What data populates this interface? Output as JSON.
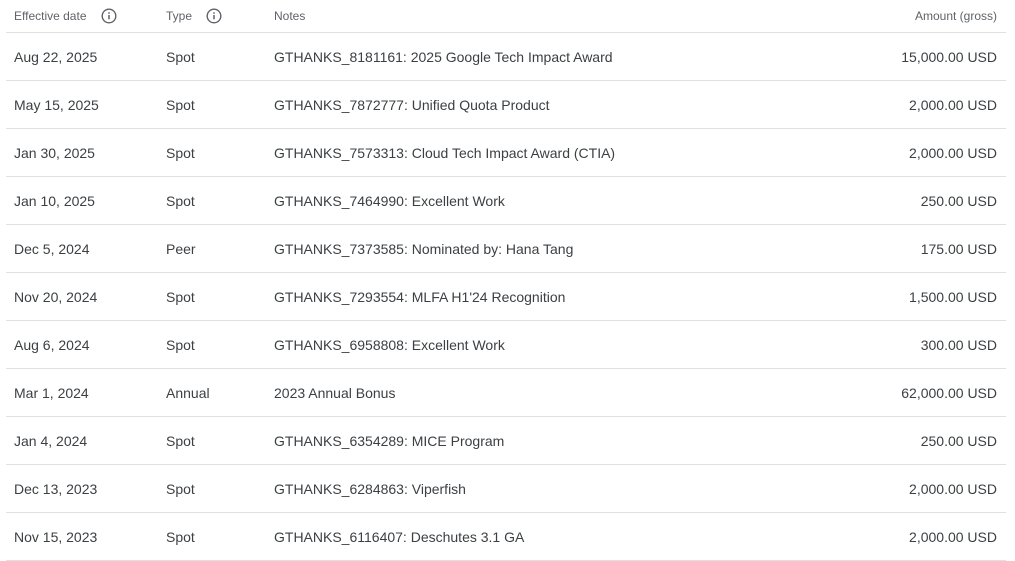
{
  "header": {
    "effective_date": "Effective date",
    "type": "Type",
    "notes": "Notes",
    "amount": "Amount (gross)",
    "info_icon": "info-icon"
  },
  "rows": [
    {
      "date": "Aug 22, 2025",
      "type": "Spot",
      "notes": "GTHANKS_8181161: 2025 Google Tech Impact Award",
      "amount": "15,000.00 USD"
    },
    {
      "date": "May 15, 2025",
      "type": "Spot",
      "notes": "GTHANKS_7872777: Unified Quota Product",
      "amount": "2,000.00 USD"
    },
    {
      "date": "Jan 30, 2025",
      "type": "Spot",
      "notes": "GTHANKS_7573313: Cloud Tech Impact Award (CTIA)",
      "amount": "2,000.00 USD"
    },
    {
      "date": "Jan 10, 2025",
      "type": "Spot",
      "notes": "GTHANKS_7464990: Excellent Work",
      "amount": "250.00 USD"
    },
    {
      "date": "Dec 5, 2024",
      "type": "Peer",
      "notes": "GTHANKS_7373585: Nominated by: Hana Tang",
      "amount": "175.00 USD"
    },
    {
      "date": "Nov 20, 2024",
      "type": "Spot",
      "notes": "GTHANKS_7293554: MLFA H1'24 Recognition",
      "amount": "1,500.00 USD"
    },
    {
      "date": "Aug 6, 2024",
      "type": "Spot",
      "notes": "GTHANKS_6958808: Excellent Work",
      "amount": "300.00 USD"
    },
    {
      "date": "Mar 1, 2024",
      "type": "Annual",
      "notes": "2023 Annual Bonus",
      "amount": "62,000.00 USD"
    },
    {
      "date": "Jan 4, 2024",
      "type": "Spot",
      "notes": "GTHANKS_6354289: MICE Program",
      "amount": "250.00 USD"
    },
    {
      "date": "Dec 13, 2023",
      "type": "Spot",
      "notes": "GTHANKS_6284863: Viperfish",
      "amount": "2,000.00 USD"
    },
    {
      "date": "Nov 15, 2023",
      "type": "Spot",
      "notes": "GTHANKS_6116407: Deschutes 3.1 GA",
      "amount": "2,000.00 USD"
    }
  ],
  "colors": {
    "text": "#3c4043",
    "header_text": "#5f6368",
    "divider": "#e0e0e0"
  }
}
